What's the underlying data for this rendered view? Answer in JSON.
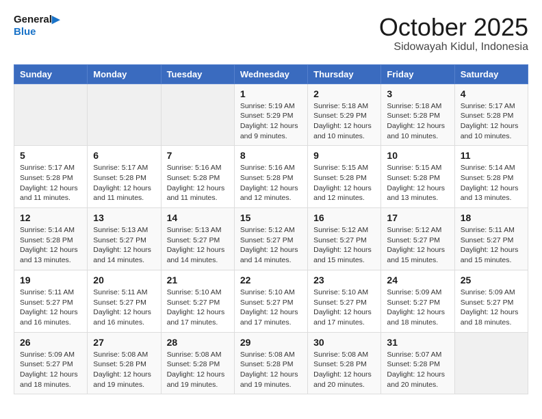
{
  "header": {
    "logo_line1": "General",
    "logo_line2": "Blue",
    "month_title": "October 2025",
    "location": "Sidowayah Kidul, Indonesia"
  },
  "weekdays": [
    "Sunday",
    "Monday",
    "Tuesday",
    "Wednesday",
    "Thursday",
    "Friday",
    "Saturday"
  ],
  "weeks": [
    [
      {
        "day": "",
        "info": ""
      },
      {
        "day": "",
        "info": ""
      },
      {
        "day": "",
        "info": ""
      },
      {
        "day": "1",
        "info": "Sunrise: 5:19 AM\nSunset: 5:29 PM\nDaylight: 12 hours\nand 9 minutes."
      },
      {
        "day": "2",
        "info": "Sunrise: 5:18 AM\nSunset: 5:29 PM\nDaylight: 12 hours\nand 10 minutes."
      },
      {
        "day": "3",
        "info": "Sunrise: 5:18 AM\nSunset: 5:28 PM\nDaylight: 12 hours\nand 10 minutes."
      },
      {
        "day": "4",
        "info": "Sunrise: 5:17 AM\nSunset: 5:28 PM\nDaylight: 12 hours\nand 10 minutes."
      }
    ],
    [
      {
        "day": "5",
        "info": "Sunrise: 5:17 AM\nSunset: 5:28 PM\nDaylight: 12 hours\nand 11 minutes."
      },
      {
        "day": "6",
        "info": "Sunrise: 5:17 AM\nSunset: 5:28 PM\nDaylight: 12 hours\nand 11 minutes."
      },
      {
        "day": "7",
        "info": "Sunrise: 5:16 AM\nSunset: 5:28 PM\nDaylight: 12 hours\nand 11 minutes."
      },
      {
        "day": "8",
        "info": "Sunrise: 5:16 AM\nSunset: 5:28 PM\nDaylight: 12 hours\nand 12 minutes."
      },
      {
        "day": "9",
        "info": "Sunrise: 5:15 AM\nSunset: 5:28 PM\nDaylight: 12 hours\nand 12 minutes."
      },
      {
        "day": "10",
        "info": "Sunrise: 5:15 AM\nSunset: 5:28 PM\nDaylight: 12 hours\nand 13 minutes."
      },
      {
        "day": "11",
        "info": "Sunrise: 5:14 AM\nSunset: 5:28 PM\nDaylight: 12 hours\nand 13 minutes."
      }
    ],
    [
      {
        "day": "12",
        "info": "Sunrise: 5:14 AM\nSunset: 5:28 PM\nDaylight: 12 hours\nand 13 minutes."
      },
      {
        "day": "13",
        "info": "Sunrise: 5:13 AM\nSunset: 5:27 PM\nDaylight: 12 hours\nand 14 minutes."
      },
      {
        "day": "14",
        "info": "Sunrise: 5:13 AM\nSunset: 5:27 PM\nDaylight: 12 hours\nand 14 minutes."
      },
      {
        "day": "15",
        "info": "Sunrise: 5:12 AM\nSunset: 5:27 PM\nDaylight: 12 hours\nand 14 minutes."
      },
      {
        "day": "16",
        "info": "Sunrise: 5:12 AM\nSunset: 5:27 PM\nDaylight: 12 hours\nand 15 minutes."
      },
      {
        "day": "17",
        "info": "Sunrise: 5:12 AM\nSunset: 5:27 PM\nDaylight: 12 hours\nand 15 minutes."
      },
      {
        "day": "18",
        "info": "Sunrise: 5:11 AM\nSunset: 5:27 PM\nDaylight: 12 hours\nand 15 minutes."
      }
    ],
    [
      {
        "day": "19",
        "info": "Sunrise: 5:11 AM\nSunset: 5:27 PM\nDaylight: 12 hours\nand 16 minutes."
      },
      {
        "day": "20",
        "info": "Sunrise: 5:11 AM\nSunset: 5:27 PM\nDaylight: 12 hours\nand 16 minutes."
      },
      {
        "day": "21",
        "info": "Sunrise: 5:10 AM\nSunset: 5:27 PM\nDaylight: 12 hours\nand 17 minutes."
      },
      {
        "day": "22",
        "info": "Sunrise: 5:10 AM\nSunset: 5:27 PM\nDaylight: 12 hours\nand 17 minutes."
      },
      {
        "day": "23",
        "info": "Sunrise: 5:10 AM\nSunset: 5:27 PM\nDaylight: 12 hours\nand 17 minutes."
      },
      {
        "day": "24",
        "info": "Sunrise: 5:09 AM\nSunset: 5:27 PM\nDaylight: 12 hours\nand 18 minutes."
      },
      {
        "day": "25",
        "info": "Sunrise: 5:09 AM\nSunset: 5:27 PM\nDaylight: 12 hours\nand 18 minutes."
      }
    ],
    [
      {
        "day": "26",
        "info": "Sunrise: 5:09 AM\nSunset: 5:27 PM\nDaylight: 12 hours\nand 18 minutes."
      },
      {
        "day": "27",
        "info": "Sunrise: 5:08 AM\nSunset: 5:28 PM\nDaylight: 12 hours\nand 19 minutes."
      },
      {
        "day": "28",
        "info": "Sunrise: 5:08 AM\nSunset: 5:28 PM\nDaylight: 12 hours\nand 19 minutes."
      },
      {
        "day": "29",
        "info": "Sunrise: 5:08 AM\nSunset: 5:28 PM\nDaylight: 12 hours\nand 19 minutes."
      },
      {
        "day": "30",
        "info": "Sunrise: 5:08 AM\nSunset: 5:28 PM\nDaylight: 12 hours\nand 20 minutes."
      },
      {
        "day": "31",
        "info": "Sunrise: 5:07 AM\nSunset: 5:28 PM\nDaylight: 12 hours\nand 20 minutes."
      },
      {
        "day": "",
        "info": ""
      }
    ]
  ]
}
